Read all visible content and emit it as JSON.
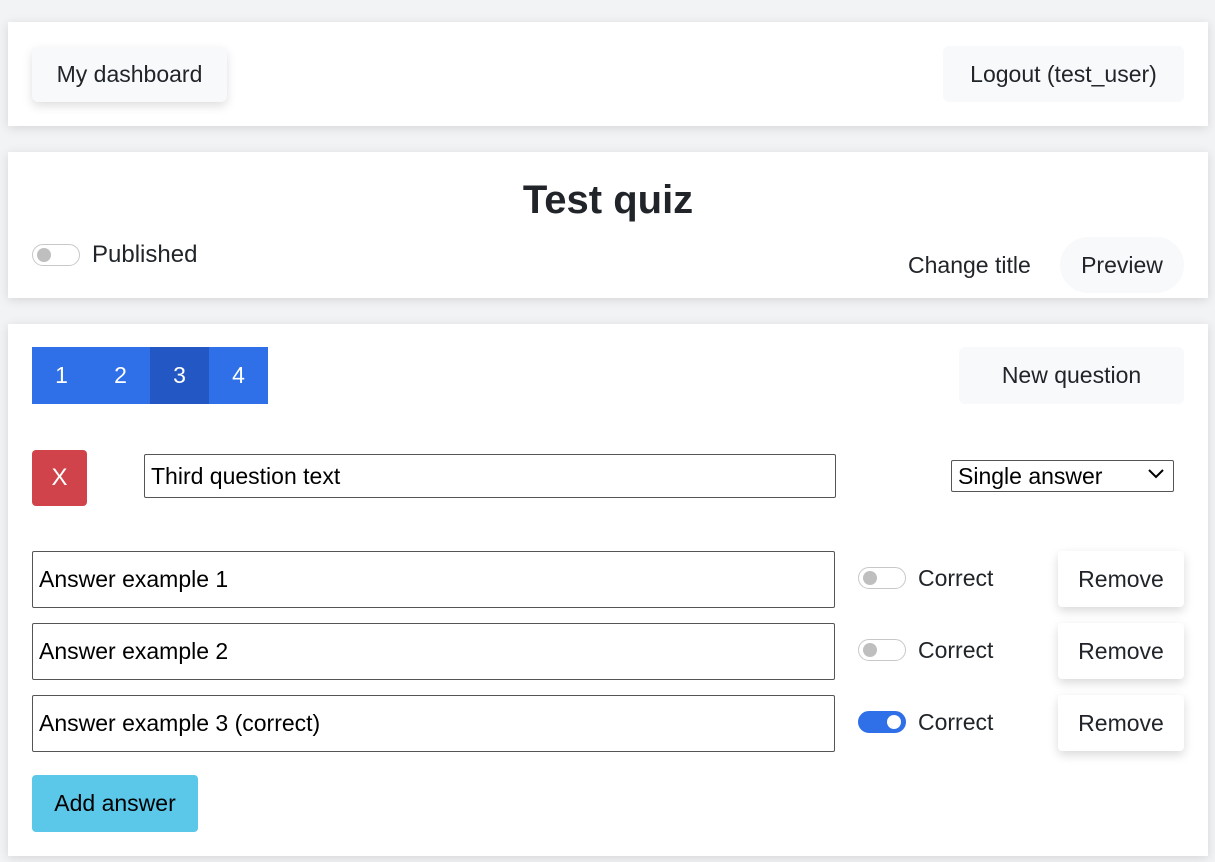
{
  "header": {
    "dashboard_label": "My dashboard",
    "logout_label": "Logout (test_user)"
  },
  "quiz": {
    "title": "Test quiz",
    "published_label": "Published",
    "published": false,
    "change_title_label": "Change title",
    "preview_label": "Preview"
  },
  "questions": {
    "tabs": [
      "1",
      "2",
      "3",
      "4"
    ],
    "active_tab": "3",
    "new_question_label": "New question"
  },
  "question": {
    "delete_label": "X",
    "text": "Third question text",
    "answer_type": "Single answer",
    "answers": [
      {
        "text": "Answer example 1",
        "correct": false,
        "correct_label": "Correct",
        "remove_label": "Remove"
      },
      {
        "text": "Answer example 2",
        "correct": false,
        "correct_label": "Correct",
        "remove_label": "Remove"
      },
      {
        "text": "Answer example 3 (correct)",
        "correct": true,
        "correct_label": "Correct",
        "remove_label": "Remove"
      }
    ],
    "add_answer_label": "Add answer"
  },
  "colors": {
    "primary": "#2f6fe8",
    "primary_active": "#2257c4",
    "danger": "#d1434b",
    "info": "#5bc8ea",
    "light": "#f8f9fa"
  }
}
